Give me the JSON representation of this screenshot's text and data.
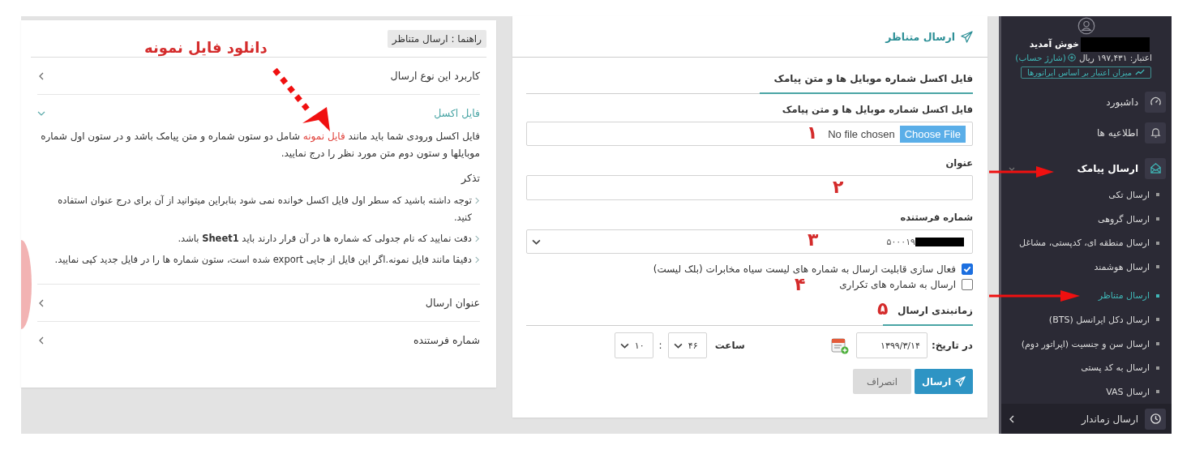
{
  "guide": {
    "title": "راهنما : ارسال متناظر",
    "sections": [
      {
        "title": "کاربرد این نوع ارسال",
        "expanded": false
      },
      {
        "title": "فایل اکسل",
        "expanded": true,
        "body_before": "فایل اکسل ورودی شما باید مانند",
        "body_link": "فایل نمونه",
        "body_after": "شامل دو ستون شماره و متن پیامک باشد و در ستون اول شماره موبایلها و ستون دوم متن مورد نظر را درج نمایید.",
        "note_title": "تذکر",
        "notes": [
          "توجه داشته باشید که سطر اول فایل اکسل خوانده نمی شود بنابراین میتوانید از آن برای درج عنوان استفاده کنید.",
          "دقت نمایید که نام جدولی که شماره ها در آن قرار دارند باید **Sheet1** باشد.",
          "دقیقا مانند فایل نمونه.اگر این فایل از جایی export شده است، ستون شماره ها را در فایل جدید کپی نمایید."
        ]
      },
      {
        "title": "عنوان ارسال",
        "expanded": false
      },
      {
        "title": "شماره فرستنده",
        "expanded": false
      }
    ]
  },
  "form": {
    "title": "ارسال متناظر",
    "tabs": [
      {
        "label": "فایل اکسل شماره موبایل ها و متن پیامک",
        "selected": true
      }
    ],
    "file_label": "فایل اکسل شماره موبایل ها و متن پیامک",
    "file_button": "Choose File",
    "file_status": "No file chosen",
    "title_label": "عنوان",
    "sender_label": "شماره فرستنده",
    "sender_value": "۵۰۰۰۱۹",
    "options": [
      {
        "label": "فعال سازی قابلیت ارسال به شماره های لیست سیاه مخابرات (بلک لیست)",
        "checked": true
      },
      {
        "label": "ارسال به شماره های تکراری",
        "checked": false
      }
    ],
    "schedule_tab": {
      "label": "زمانبندی ارسال",
      "selected": true
    },
    "date_label": "در تاریخ:",
    "date_value": "۱۳۹۹/۳/۱۴",
    "time_label": "ساعت",
    "time_values": [
      "۴۶",
      "۱۰"
    ],
    "time_separator": ":",
    "submit": "ارسال",
    "cancel": "انصراف"
  },
  "sidebar": {
    "welcome": "خوش آمدید",
    "credit": "اعتبار: ۱۹۷,۴۳۱ ریال",
    "charge_link": "(شارژ حساب)",
    "operator_button": "میزان اعتبار بر اساس اپراتورها",
    "menu": [
      {
        "label": "داشبورد",
        "selected": false
      },
      {
        "label": "اطلاعیه ها",
        "selected": false
      },
      {
        "label": "ارسال پیامک",
        "selected": true,
        "expanded": true,
        "children": [
          {
            "label": "ارسال تکی",
            "selected": false
          },
          {
            "label": "ارسال گروهی",
            "selected": false
          },
          {
            "label": "ارسال منطقه ای، کدپستی، مشاغل",
            "selected": false
          },
          {
            "label": "ارسال هوشمند",
            "selected": false
          },
          {
            "label": "ارسال متناظر",
            "selected": true
          },
          {
            "label": "ارسال دکل ایرانسل (BTS)",
            "selected": false
          },
          {
            "label": "ارسال سن و جنسیت (اپراتور دوم)",
            "selected": false
          },
          {
            "label": "ارسال به کد پستی",
            "selected": false
          },
          {
            "label": "ارسال VAS",
            "selected": false
          }
        ]
      },
      {
        "label": "ارسال زماندار",
        "selected": false,
        "expanded": false
      }
    ]
  },
  "annotations": {
    "caption": "دانلود فایل نمونه",
    "markers": [
      "۱",
      "۲",
      "۳",
      "۴",
      "۵"
    ]
  }
}
